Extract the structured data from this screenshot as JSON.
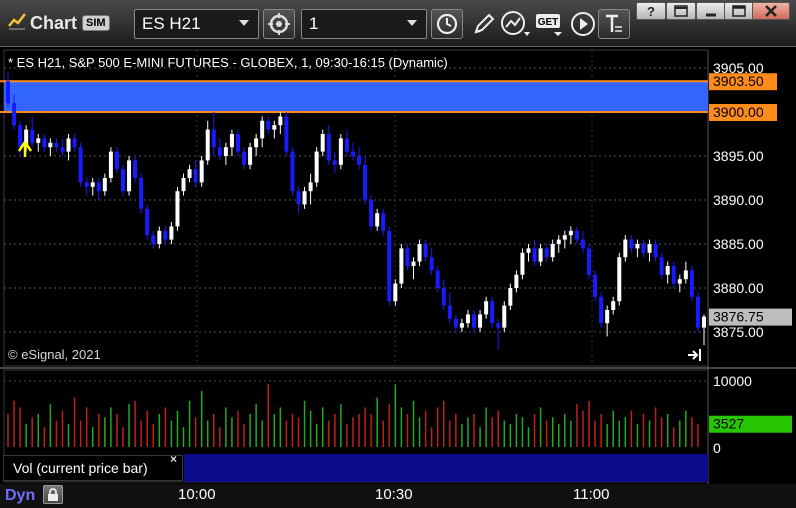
{
  "titlebar": {
    "title": "Chart",
    "sim_badge": "SIM",
    "symbol": "ES H21",
    "interval": "1",
    "buttons": [
      "crosshair-icon",
      "clock-icon",
      "pencil-icon",
      "studies-icon",
      "get-icon",
      "play-icon",
      "text-icon"
    ],
    "window_buttons": [
      "help-icon",
      "restore-icon",
      "minimize-icon",
      "maximize-icon",
      "close-icon"
    ]
  },
  "chart": {
    "header": "* ES H21, S&P 500 E-MINI FUTURES - GLOBEX, 1, 09:30-16:15 (Dynamic)",
    "copyright": "© eSignal, 2021",
    "colors": {
      "up": "#ffffff",
      "down": "#1a1aff",
      "zone": "#3366ff",
      "line": "#ff8c1a",
      "vol_up": "#22aa22",
      "vol_down": "#c0201a",
      "last": "#bdbdbd",
      "vol_last": "#27c400"
    },
    "price_axis": {
      "ticks": [
        "3905.00",
        "3903.50",
        "3900.00",
        "3895.00",
        "3890.00",
        "3885.00",
        "3880.00",
        "3876.75",
        "3875.00"
      ],
      "labels": [
        "3905.00",
        "3895.00",
        "3890.00",
        "3885.00",
        "3880.00",
        "3875.00"
      ],
      "line_tags": [
        "3903.50",
        "3900.00"
      ],
      "last_price": "3876.75"
    },
    "volume_axis": {
      "labels": [
        "10000",
        "0"
      ],
      "last_volume": "3527",
      "pane_label": "Vol (current price bar)"
    },
    "time_axis": [
      "10:00",
      "10:30",
      "11:00"
    ]
  },
  "chart_data": {
    "type": "candlestick",
    "symbol": "ES H21",
    "ylim": [
      3872.5,
      3907.0
    ],
    "horizontal_lines": [
      3903.5,
      3900.0
    ],
    "shaded_zone": [
      3900.0,
      3903.5
    ],
    "candles": [
      [
        3903.5,
        3904.5,
        3900.5,
        3901.0
      ],
      [
        3901.0,
        3902.0,
        3898.0,
        3898.5
      ],
      [
        3898.5,
        3899.0,
        3895.0,
        3896.0
      ],
      [
        3896.0,
        3898.5,
        3895.5,
        3898.0
      ],
      [
        3898.0,
        3899.5,
        3896.0,
        3896.5
      ],
      [
        3896.5,
        3897.5,
        3895.5,
        3897.0
      ],
      [
        3897.0,
        3897.5,
        3895.5,
        3896.0
      ],
      [
        3896.0,
        3897.0,
        3895.0,
        3896.5
      ],
      [
        3896.5,
        3897.0,
        3895.5,
        3896.0
      ],
      [
        3896.0,
        3897.0,
        3895.0,
        3895.5
      ],
      [
        3895.5,
        3897.5,
        3894.5,
        3897.0
      ],
      [
        3897.0,
        3897.5,
        3895.5,
        3896.0
      ],
      [
        3896.0,
        3896.5,
        3891.5,
        3892.0
      ],
      [
        3892.0,
        3892.5,
        3890.5,
        3891.5
      ],
      [
        3891.5,
        3892.5,
        3890.5,
        3892.0
      ],
      [
        3892.0,
        3892.5,
        3890.0,
        3891.0
      ],
      [
        3891.0,
        3893.0,
        3890.5,
        3892.5
      ],
      [
        3892.5,
        3896.0,
        3892.0,
        3895.5
      ],
      [
        3895.5,
        3896.0,
        3893.0,
        3893.5
      ],
      [
        3893.5,
        3894.0,
        3890.5,
        3891.0
      ],
      [
        3891.0,
        3895.0,
        3890.5,
        3894.5
      ],
      [
        3894.5,
        3895.0,
        3892.0,
        3892.5
      ],
      [
        3892.5,
        3893.0,
        3888.5,
        3889.0
      ],
      [
        3889.0,
        3889.5,
        3885.5,
        3886.0
      ],
      [
        3886.0,
        3886.5,
        3884.5,
        3885.0
      ],
      [
        3885.0,
        3887.0,
        3884.5,
        3886.5
      ],
      [
        3886.5,
        3887.0,
        3885.0,
        3885.5
      ],
      [
        3885.5,
        3887.5,
        3885.0,
        3887.0
      ],
      [
        3887.0,
        3891.5,
        3886.5,
        3891.0
      ],
      [
        3891.0,
        3893.0,
        3890.5,
        3892.5
      ],
      [
        3892.5,
        3894.0,
        3892.0,
        3893.5
      ],
      [
        3893.5,
        3894.5,
        3891.5,
        3892.0
      ],
      [
        3892.0,
        3895.0,
        3891.5,
        3894.5
      ],
      [
        3894.5,
        3899.0,
        3894.0,
        3898.0
      ],
      [
        3898.0,
        3900.0,
        3895.0,
        3896.0
      ],
      [
        3896.0,
        3897.0,
        3894.5,
        3895.0
      ],
      [
        3895.0,
        3896.5,
        3894.0,
        3896.0
      ],
      [
        3896.0,
        3898.0,
        3895.0,
        3897.5
      ],
      [
        3897.5,
        3898.0,
        3895.0,
        3895.5
      ],
      [
        3895.5,
        3896.0,
        3893.5,
        3894.0
      ],
      [
        3894.0,
        3896.5,
        3893.5,
        3896.0
      ],
      [
        3896.0,
        3897.5,
        3895.0,
        3897.0
      ],
      [
        3897.0,
        3899.5,
        3896.0,
        3899.0
      ],
      [
        3899.0,
        3899.5,
        3897.5,
        3898.0
      ],
      [
        3898.0,
        3899.0,
        3897.0,
        3898.5
      ],
      [
        3898.5,
        3900.0,
        3897.5,
        3899.5
      ],
      [
        3899.5,
        3900.0,
        3895.0,
        3895.5
      ],
      [
        3895.5,
        3896.0,
        3890.5,
        3891.0
      ],
      [
        3891.0,
        3891.5,
        3888.5,
        3889.5
      ],
      [
        3889.5,
        3891.5,
        3889.0,
        3891.0
      ],
      [
        3891.0,
        3893.0,
        3889.5,
        3892.0
      ],
      [
        3892.0,
        3896.0,
        3891.5,
        3895.5
      ],
      [
        3895.5,
        3898.0,
        3895.0,
        3897.5
      ],
      [
        3897.5,
        3898.5,
        3894.0,
        3894.5
      ],
      [
        3894.5,
        3895.5,
        3893.0,
        3894.0
      ],
      [
        3894.0,
        3897.5,
        3893.5,
        3897.0
      ],
      [
        3897.0,
        3898.0,
        3895.0,
        3895.5
      ],
      [
        3895.5,
        3896.5,
        3894.5,
        3895.0
      ],
      [
        3895.0,
        3896.0,
        3893.5,
        3894.0
      ],
      [
        3894.0,
        3895.0,
        3889.5,
        3890.0
      ],
      [
        3890.0,
        3890.5,
        3886.5,
        3887.0
      ],
      [
        3887.0,
        3889.0,
        3886.5,
        3888.5
      ],
      [
        3888.5,
        3889.0,
        3886.0,
        3886.5
      ],
      [
        3886.5,
        3887.0,
        3878.0,
        3878.5
      ],
      [
        3878.5,
        3881.0,
        3878.0,
        3880.5
      ],
      [
        3880.5,
        3885.0,
        3880.0,
        3884.5
      ],
      [
        3884.5,
        3885.0,
        3882.0,
        3882.5
      ],
      [
        3882.5,
        3883.5,
        3881.0,
        3883.0
      ],
      [
        3883.0,
        3885.5,
        3882.5,
        3885.0
      ],
      [
        3885.0,
        3885.5,
        3883.0,
        3883.5
      ],
      [
        3883.5,
        3884.5,
        3881.5,
        3882.0
      ],
      [
        3882.0,
        3882.5,
        3879.5,
        3880.0
      ],
      [
        3880.0,
        3881.0,
        3877.5,
        3878.0
      ],
      [
        3878.0,
        3879.5,
        3876.0,
        3876.5
      ],
      [
        3876.5,
        3877.0,
        3875.0,
        3875.5
      ],
      [
        3875.5,
        3876.5,
        3875.0,
        3876.0
      ],
      [
        3876.0,
        3877.5,
        3875.5,
        3877.0
      ],
      [
        3877.0,
        3877.5,
        3875.0,
        3875.5
      ],
      [
        3875.5,
        3877.5,
        3875.0,
        3877.0
      ],
      [
        3877.0,
        3879.0,
        3876.5,
        3878.5
      ],
      [
        3878.5,
        3879.0,
        3875.5,
        3876.0
      ],
      [
        3876.0,
        3876.5,
        3873.0,
        3875.5
      ],
      [
        3875.5,
        3878.5,
        3875.0,
        3878.0
      ],
      [
        3878.0,
        3880.5,
        3877.5,
        3880.0
      ],
      [
        3880.0,
        3882.0,
        3879.5,
        3881.5
      ],
      [
        3881.5,
        3884.5,
        3881.0,
        3884.0
      ],
      [
        3884.0,
        3885.0,
        3883.0,
        3884.5
      ],
      [
        3884.5,
        3885.5,
        3882.5,
        3883.0
      ],
      [
        3883.0,
        3885.0,
        3882.5,
        3884.5
      ],
      [
        3884.5,
        3885.0,
        3883.0,
        3883.5
      ],
      [
        3883.5,
        3885.5,
        3883.0,
        3885.0
      ],
      [
        3885.0,
        3886.0,
        3884.0,
        3885.5
      ],
      [
        3885.5,
        3886.5,
        3884.5,
        3886.0
      ],
      [
        3886.0,
        3887.0,
        3885.0,
        3886.5
      ],
      [
        3886.5,
        3887.0,
        3885.0,
        3885.5
      ],
      [
        3885.5,
        3886.5,
        3884.0,
        3884.5
      ],
      [
        3884.5,
        3885.0,
        3881.0,
        3881.5
      ],
      [
        3881.5,
        3882.0,
        3878.5,
        3879.0
      ],
      [
        3879.0,
        3879.5,
        3875.5,
        3876.0
      ],
      [
        3876.0,
        3878.0,
        3874.5,
        3877.5
      ],
      [
        3877.5,
        3879.0,
        3877.0,
        3878.5
      ],
      [
        3878.5,
        3884.0,
        3878.0,
        3883.5
      ],
      [
        3883.5,
        3886.0,
        3883.0,
        3885.5
      ],
      [
        3885.5,
        3886.0,
        3884.0,
        3884.5
      ],
      [
        3884.5,
        3885.5,
        3883.5,
        3885.0
      ],
      [
        3885.0,
        3885.5,
        3883.5,
        3884.0
      ],
      [
        3884.0,
        3885.5,
        3883.0,
        3885.0
      ],
      [
        3885.0,
        3885.5,
        3883.0,
        3883.5
      ],
      [
        3883.5,
        3884.0,
        3881.0,
        3881.5
      ],
      [
        3881.5,
        3883.0,
        3880.5,
        3882.5
      ],
      [
        3882.5,
        3883.0,
        3880.0,
        3880.5
      ],
      [
        3880.5,
        3881.5,
        3879.5,
        3881.0
      ],
      [
        3881.0,
        3883.0,
        3880.5,
        3882.0
      ],
      [
        3882.0,
        3882.5,
        3878.5,
        3879.0
      ],
      [
        3879.0,
        3879.5,
        3875.0,
        3875.5
      ],
      [
        3875.5,
        3877.0,
        3873.5,
        3876.75
      ]
    ],
    "volume_ylim": [
      0,
      11000
    ],
    "volume": [
      5000,
      7000,
      6000,
      3500,
      4500,
      5000,
      3000,
      6500,
      4000,
      5500,
      3500,
      7500,
      4000,
      6000,
      3000,
      5000,
      4500,
      6000,
      5000,
      3000,
      6500,
      7000,
      4000,
      5500,
      3500,
      5000,
      6000,
      4000,
      5500,
      3000,
      7000,
      4500,
      8500,
      4000,
      5000,
      3000,
      6000,
      4500,
      5500,
      3500,
      5000,
      6500,
      4000,
      9500,
      5000,
      6000,
      4000,
      5000,
      4500,
      7000,
      5500,
      3500,
      6000,
      4000,
      5000,
      6500,
      3500,
      4500,
      5000,
      6000,
      5000,
      7500,
      4000,
      6500,
      9500,
      6000,
      5000,
      7000,
      4500,
      5500,
      3000,
      6000,
      7000,
      4000,
      5000,
      3500,
      4500,
      5000,
      3000,
      6000,
      4500,
      5500,
      4000,
      3500,
      5000,
      4500,
      3000,
      5000,
      6000,
      4000,
      4500,
      3500,
      5000,
      4000,
      6500,
      5500,
      7000,
      4000,
      5000,
      3500,
      5500,
      4000,
      4500,
      5500,
      3500,
      5000,
      4000,
      6000,
      4500,
      5000,
      3000,
      4000,
      5500,
      4500,
      3527
    ]
  }
}
